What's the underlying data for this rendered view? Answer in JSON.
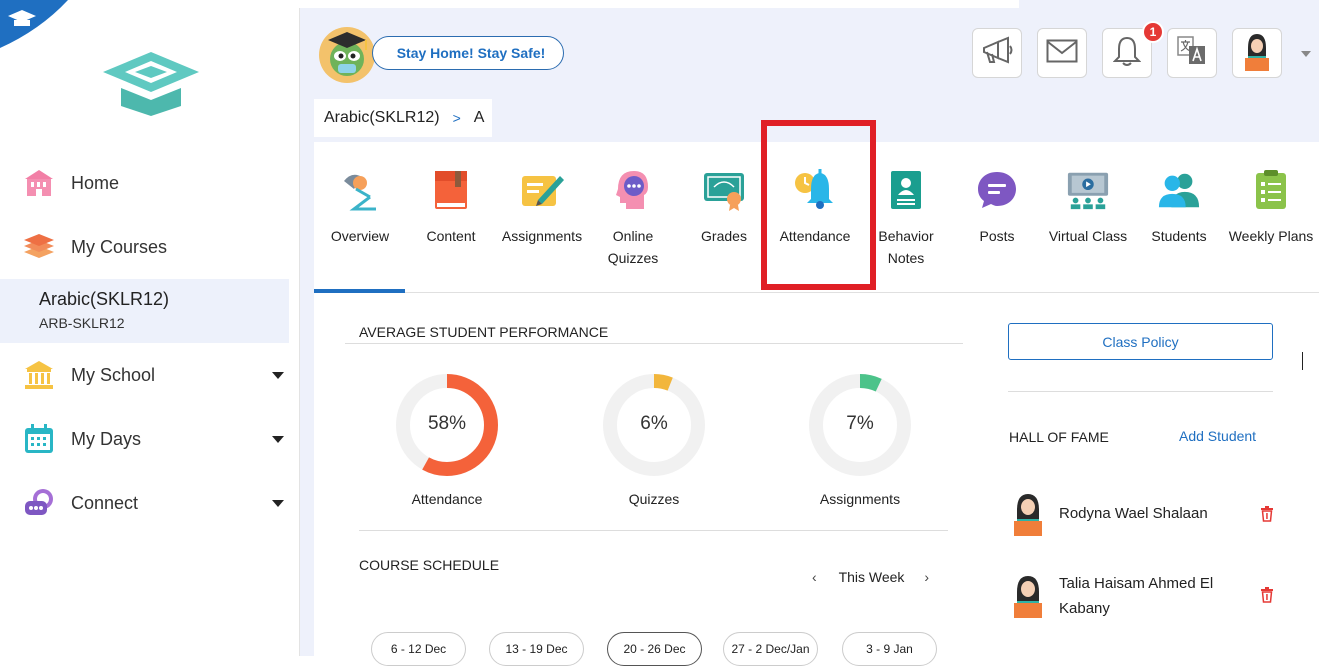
{
  "sidebar": {
    "items": [
      {
        "label": "Home",
        "icon": "school-building-icon"
      },
      {
        "label": "My Courses",
        "icon": "stacked-books-icon"
      },
      {
        "label": "My School",
        "icon": "institution-icon"
      },
      {
        "label": "My Days",
        "icon": "calendar-icon"
      },
      {
        "label": "Connect",
        "icon": "chat-bubbles-icon"
      }
    ],
    "active_course": {
      "name": "Arabic(SKLR12)",
      "code": "ARB-SKLR12"
    }
  },
  "header": {
    "banner": "Stay Home! Stay Safe!",
    "notification_count": "1"
  },
  "breadcrumb": {
    "course": "Arabic(SKLR12)",
    "separator": ">",
    "section": "A"
  },
  "tabs": [
    {
      "line1": "Overview",
      "line2": ""
    },
    {
      "line1": "Content",
      "line2": ""
    },
    {
      "line1": "Assignments",
      "line2": ""
    },
    {
      "line1": "Online",
      "line2": "Quizzes"
    },
    {
      "line1": "Grades",
      "line2": ""
    },
    {
      "line1": "Attendance",
      "line2": ""
    },
    {
      "line1": "Behavior",
      "line2": "Notes"
    },
    {
      "line1": "Posts",
      "line2": ""
    },
    {
      "line1": "Virtual Class",
      "line2": ""
    },
    {
      "line1": "Students",
      "line2": ""
    },
    {
      "line1": "Weekly Plans",
      "line2": ""
    }
  ],
  "performance": {
    "title": "AVERAGE STUDENT PERFORMANCE",
    "metrics": [
      {
        "value": "58%",
        "fraction": 0.58,
        "label": "Attendance",
        "color": "#f4623a"
      },
      {
        "value": "6%",
        "fraction": 0.06,
        "label": "Quizzes",
        "color": "#f2b63c"
      },
      {
        "value": "7%",
        "fraction": 0.07,
        "label": "Assignments",
        "color": "#4cc38a"
      }
    ]
  },
  "schedule": {
    "title": "COURSE SCHEDULE",
    "prev": "‹",
    "period": "This Week",
    "next": "›",
    "weeks": [
      "6 - 12 Dec",
      "13 - 19 Dec",
      "20 - 26 Dec",
      "27 - 2 Dec/Jan",
      "3 - 9 Jan"
    ]
  },
  "right": {
    "policy_button": "Class Policy",
    "hall_of_fame_title": "HALL OF FAME",
    "add_student": "Add Student",
    "students": [
      {
        "line1": "Rodyna Wael Shalaan",
        "line2": ""
      },
      {
        "line1": "Talia Haisam Ahmed El",
        "line2": "Kabany"
      }
    ]
  },
  "colors": {
    "accent": "#1f6fc1",
    "highlight": "#e01f26",
    "badge": "#e53935"
  }
}
